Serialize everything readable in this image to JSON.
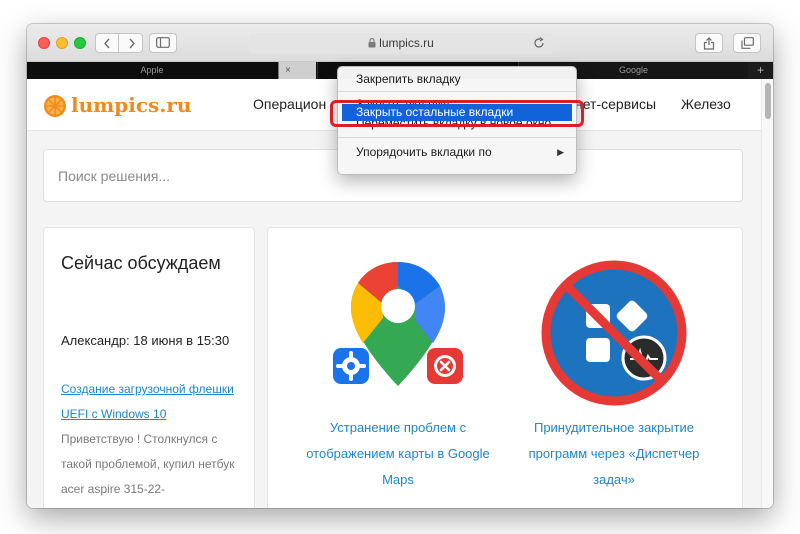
{
  "browser": {
    "address": "lumpics.ru",
    "tabs": {
      "apple": "Apple",
      "close_glyph": "×",
      "google": "Google",
      "new_tab": "+"
    }
  },
  "site": {
    "logo": "lumpics.ru",
    "nav": [
      "Операцион",
      "нет-сервисы",
      "Железо"
    ],
    "search_placeholder": "Поиск решения..."
  },
  "sidebar": {
    "title": "Сейчас обсуждаем",
    "meta": "Александр: 18 июня в 15:30",
    "link": "Создание загрузочной флешки UEFI с Windows 10",
    "text": "Приветствую ! Столкнулся с такой проблемой, купил нетбук acer aspire 315-22-"
  },
  "articles": [
    {
      "title": "Устранение проблем с отображением карты в Google Maps"
    },
    {
      "title": "Принудительное закрытие программ через «Диспетчер задач»"
    }
  ],
  "context_menu": {
    "items": [
      "Закрепить вкладку",
      "Закрыть вкладку",
      "Закрыть остальные вкладки",
      "Переместить вкладку в новое окно",
      "Упорядочить вкладки по"
    ],
    "submenu_arrow": "▶"
  },
  "colors": {
    "accent_orange": "#f28a1a",
    "link_blue": "#1f86c7",
    "menu_highlight": "#1262d9",
    "annotation_red": "#d61f26"
  }
}
